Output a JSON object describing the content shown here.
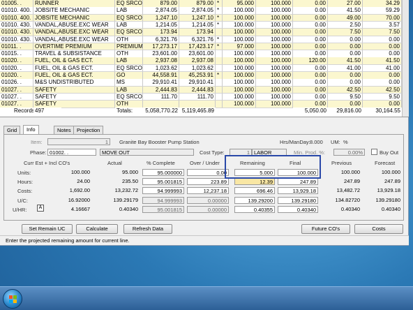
{
  "grid": {
    "rows": [
      {
        "code": "01005.  .",
        "desc": "RUNNER",
        "type": "EQ SRCO",
        "a": "879.00",
        "b": "879.00",
        "s": "*",
        "c": "95.000",
        "d": "100.000",
        "e": "0.00",
        "f": "27.00",
        "g": "34.29",
        "hl": true
      },
      {
        "code": "01010. 400.",
        "desc": "JOBSITE MECHANIC",
        "type": "LAB",
        "a": "2,874.05",
        "b": "2,874.05",
        "s": "*",
        "c": "100.000",
        "d": "100.000",
        "e": "0.00",
        "f": "41.50",
        "g": "59.29",
        "hl": false
      },
      {
        "code": "01010. 400.",
        "desc": "JOBSITE MECHANIC",
        "type": "EQ SRCO",
        "a": "1,247.10",
        "b": "1,247.10",
        "s": "*",
        "c": "100.000",
        "d": "100.000",
        "e": "0.00",
        "f": "49.00",
        "g": "70.00",
        "hl": true
      },
      {
        "code": "01010. 430.",
        "desc": "VANDAL,ABUSE.EXC WEAR",
        "type": "LAB",
        "a": "1,214.05",
        "b": "1,214.05",
        "s": "*",
        "c": "100.000",
        "d": "100.000",
        "e": "0.00",
        "f": "2.50",
        "g": "3.57",
        "hl": false
      },
      {
        "code": "01010. 430.",
        "desc": "VANDAL,ABUSE.EXC WEAR",
        "type": "EQ SRCO",
        "a": "173.94",
        "b": "173.94",
        "s": "",
        "c": "100.000",
        "d": "100.000",
        "e": "0.00",
        "f": "7.50",
        "g": "7.50",
        "hl": true
      },
      {
        "code": "01010. 430.",
        "desc": "VANDAL,ABUSE.EXC WEAR",
        "type": "OTH",
        "a": "6,321.76",
        "b": "6,321.76",
        "s": "*",
        "c": "100.000",
        "d": "100.000",
        "e": "0.00",
        "f": "0.00",
        "g": "0.00",
        "hl": false
      },
      {
        "code": "01011.  .",
        "desc": "OVERTIME PREMIUM",
        "type": "PREMIUM",
        "a": "17,273.17",
        "b": "17,423.17",
        "s": "*",
        "c": "97.000",
        "d": "100.000",
        "e": "0.00",
        "f": "0.00",
        "g": "0.00",
        "hl": true
      },
      {
        "code": "01015.  .",
        "desc": "TRAVEL & SUBSISTANCE",
        "type": "OTH",
        "a": "23,601.00",
        "b": "23,601.00",
        "s": "",
        "c": "100.000",
        "d": "100.000",
        "e": "0.00",
        "f": "0.00",
        "g": "0.00",
        "hl": false
      },
      {
        "code": "01020.  .",
        "desc": "FUEL, OIL & GAS ECT.",
        "type": "LAB",
        "a": "2,937.08",
        "b": "2,937.08",
        "s": "",
        "c": "100.000",
        "d": "100.000",
        "e": "120.00",
        "f": "41.50",
        "g": "41.50",
        "hl": true
      },
      {
        "code": "01020.  .",
        "desc": "FUEL, OIL & GAS ECT.",
        "type": "EQ SRCO",
        "a": "1,023.62",
        "b": "1,023.62",
        "s": "",
        "c": "100.000",
        "d": "100.000",
        "e": "0.00",
        "f": "41.00",
        "g": "41.00",
        "hl": false
      },
      {
        "code": "01020.  .",
        "desc": "FUEL, OIL & GAS ECT.",
        "type": "GO",
        "a": "44,558.91",
        "b": "45,253.91",
        "s": "*",
        "c": "100.000",
        "d": "100.000",
        "e": "0.00",
        "f": "0.00",
        "g": "0.00",
        "hl": true
      },
      {
        "code": "01026.  .",
        "desc": "M&S UNDISTRIBUTED",
        "type": "MS",
        "a": "29,910.41",
        "b": "29,910.41",
        "s": "",
        "c": "100.000",
        "d": "100.000",
        "e": "0.00",
        "f": "0.00",
        "g": "0.00",
        "hl": false
      },
      {
        "code": "01027.  .",
        "desc": "SAFETY",
        "type": "LAB",
        "a": "2,444.83",
        "b": "2,444.83",
        "s": "",
        "c": "100.000",
        "d": "100.000",
        "e": "0.00",
        "f": "42.50",
        "g": "42.50",
        "hl": true
      },
      {
        "code": "01027.  .",
        "desc": "SAFETY",
        "type": "EQ SRCO",
        "a": "111.70",
        "b": "111.70",
        "s": "",
        "c": "100.000",
        "d": "100.000",
        "e": "0.00",
        "f": "9.50",
        "g": "9.50",
        "hl": false
      },
      {
        "code": "01027.  .",
        "desc": "SAFETY",
        "type": "OTH",
        "a": "",
        "b": "",
        "s": "",
        "c": "100.000",
        "d": "100.000",
        "e": "0.00",
        "f": "0.00",
        "g": "0.00",
        "hl": true
      }
    ],
    "totals": {
      "label": "Totals:",
      "a": "5,058,770.22",
      "b": "5,119,465.89",
      "e": "5,050.00",
      "f": "29,816.00",
      "g": "30,164.55"
    },
    "records_label": "Records:",
    "records_count": "497"
  },
  "tabs": [
    "Grid",
    "Info",
    "Notes",
    "Projection Detail"
  ],
  "info": {
    "item_label": "Item:",
    "item_value": "1",
    "item_desc": "Granite Bay Booster Pump Station",
    "hrs_label": "Hrs/ManDay:",
    "hrs_value": "8.000",
    "um_label": "UM:",
    "um_value": "%",
    "phase_label": "Phase:",
    "phase_value": "01002.  .",
    "phase_desc": "MOVE OUT",
    "cost_type_label": "Cost Type:",
    "cost_type_num": "1",
    "cost_type_name": "LABOR",
    "min_prod_label": "Min. Prod. %:",
    "min_prod_value": "0.00%",
    "buy_out_label": "Buy Out"
  },
  "columns": [
    "Curr Est + Incl CO's",
    "Actual",
    "% Complete",
    "Over / Under",
    "Remaining",
    "Final",
    "Previous",
    "Forecast"
  ],
  "metrics": [
    {
      "label": "Units:",
      "curr": "100.000",
      "actual": "95.000",
      "pct": "95.000000",
      "over": "0.00",
      "rem": "5.000",
      "final": "100.000",
      "prev": "100.000",
      "fore": "100.000"
    },
    {
      "label": "Hours:",
      "curr": "24.00",
      "actual": "235.50",
      "pct": "95.001815",
      "over": "223.89",
      "rem": "12.39",
      "final": "247.89",
      "prev": "247.89",
      "fore": "247.89"
    },
    {
      "label": "Costs:",
      "curr": "1,692.00",
      "actual": "13,232.72",
      "pct": "94.999993",
      "over": "12,237.18",
      "rem": "696.46",
      "final": "13,929.18",
      "prev": "13,482.72",
      "fore": "13,929.18"
    },
    {
      "label": "U/C:",
      "curr": "16.92000",
      "actual": "139.29179",
      "pct": "94.999993",
      "over": "0.00000",
      "rem": "139.29200",
      "final": "139.29180",
      "prev": "134.82720",
      "fore": "139.29180"
    },
    {
      "label": "U/HR:",
      "curr": "4.16667",
      "actual": "0.40340",
      "pct": "95.001815",
      "over": "0.00000",
      "rem": "0.40355",
      "final": "0.40340",
      "prev": "0.40340",
      "fore": "0.40340"
    }
  ],
  "uhr_toggle": "A",
  "buttons": {
    "set_remain": "Set Remain UC",
    "calculate": "Calculate",
    "refresh": "Refresh Data",
    "future": "Future CO's",
    "costs": "Costs"
  },
  "status_text": "Enter the projected remaining amount for current line.",
  "colors": {
    "highlight_border": "#2948a8",
    "row_highlight": "#fbf7cf"
  }
}
